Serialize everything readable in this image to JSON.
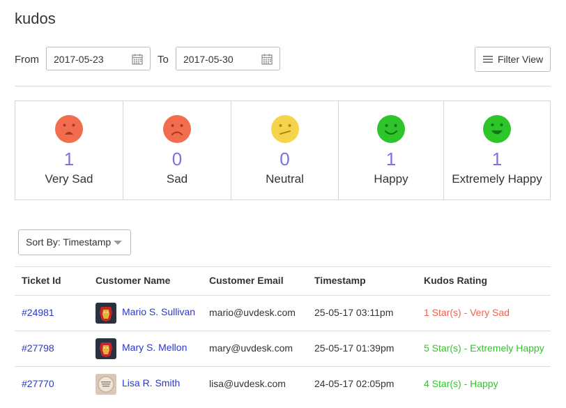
{
  "page": {
    "title": "kudos"
  },
  "filters": {
    "from_label": "From",
    "from_value": "2017-05-23",
    "to_label": "To",
    "to_value": "2017-05-30",
    "filter_view_label": "Filter View"
  },
  "stats": [
    {
      "count": "1",
      "label": "Very Sad",
      "color": "#f26d4d"
    },
    {
      "count": "0",
      "label": "Sad",
      "color": "#f26d4d"
    },
    {
      "count": "0",
      "label": "Neutral",
      "color": "#f5d44a"
    },
    {
      "count": "1",
      "label": "Happy",
      "color": "#2ec52a"
    },
    {
      "count": "1",
      "label": "Extremely Happy",
      "color": "#2ec52a"
    }
  ],
  "sort": {
    "label": "Sort By: Timestamp"
  },
  "table": {
    "headers": [
      "Ticket Id",
      "Customer Name",
      "Customer Email",
      "Timestamp",
      "Kudos Rating"
    ],
    "rows": [
      {
        "ticket": "#24981",
        "name": "Mario S. Sullivan",
        "email": "mario@uvdesk.com",
        "timestamp": "25-05-17 03:11pm",
        "rating": "1 Star(s) - Very Sad",
        "rating_color": "#f2624b",
        "avatar": "ironman-avatar"
      },
      {
        "ticket": "#27798",
        "name": "Mary S. Mellon",
        "email": "mary@uvdesk.com",
        "timestamp": "25-05-17 01:39pm",
        "rating": "5 Star(s) - Extremely Happy",
        "rating_color": "#31c42a",
        "avatar": "ironman-avatar"
      },
      {
        "ticket": "#27770",
        "name": "Lisa R. Smith",
        "email": "lisa@uvdesk.com",
        "timestamp": "24-05-17 02:05pm",
        "rating": "4 Star(s) - Happy",
        "rating_color": "#31c42a",
        "avatar": "photo-avatar"
      }
    ]
  }
}
